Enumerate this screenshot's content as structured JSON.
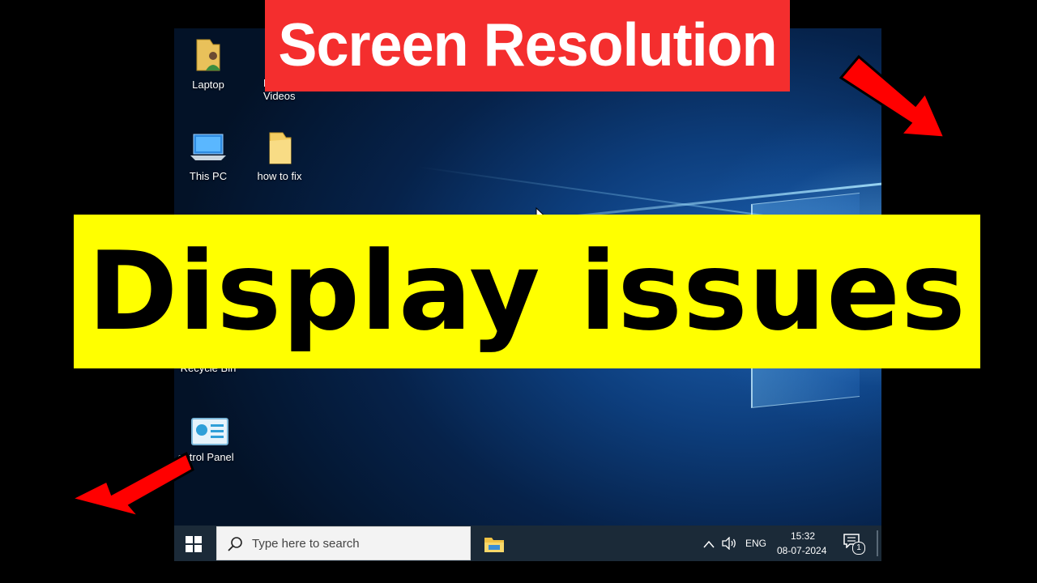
{
  "banners": {
    "top_title": "Screen Resolution",
    "main_title": "Display issues"
  },
  "desktop_icons": [
    {
      "label": "Laptop",
      "icon": "folder-user-icon"
    },
    {
      "label": "H\nVideos",
      "icon": "folder-icon"
    },
    {
      "label": "This PC",
      "icon": "computer-icon"
    },
    {
      "label": "how to fix",
      "icon": "folder-icon"
    },
    {
      "label": "Recycle Bin",
      "icon": "recycle-bin-icon"
    },
    {
      "label": "ontrol Panel",
      "icon": "control-panel-icon"
    }
  ],
  "taskbar": {
    "search_placeholder": "Type here to search",
    "language": "ENG",
    "time": "15:32",
    "date": "08-07-2024",
    "notification_count": "1"
  },
  "colors": {
    "red_banner": "#f42e2e",
    "yellow_banner": "#ffff00",
    "arrows": "#ff0000"
  }
}
